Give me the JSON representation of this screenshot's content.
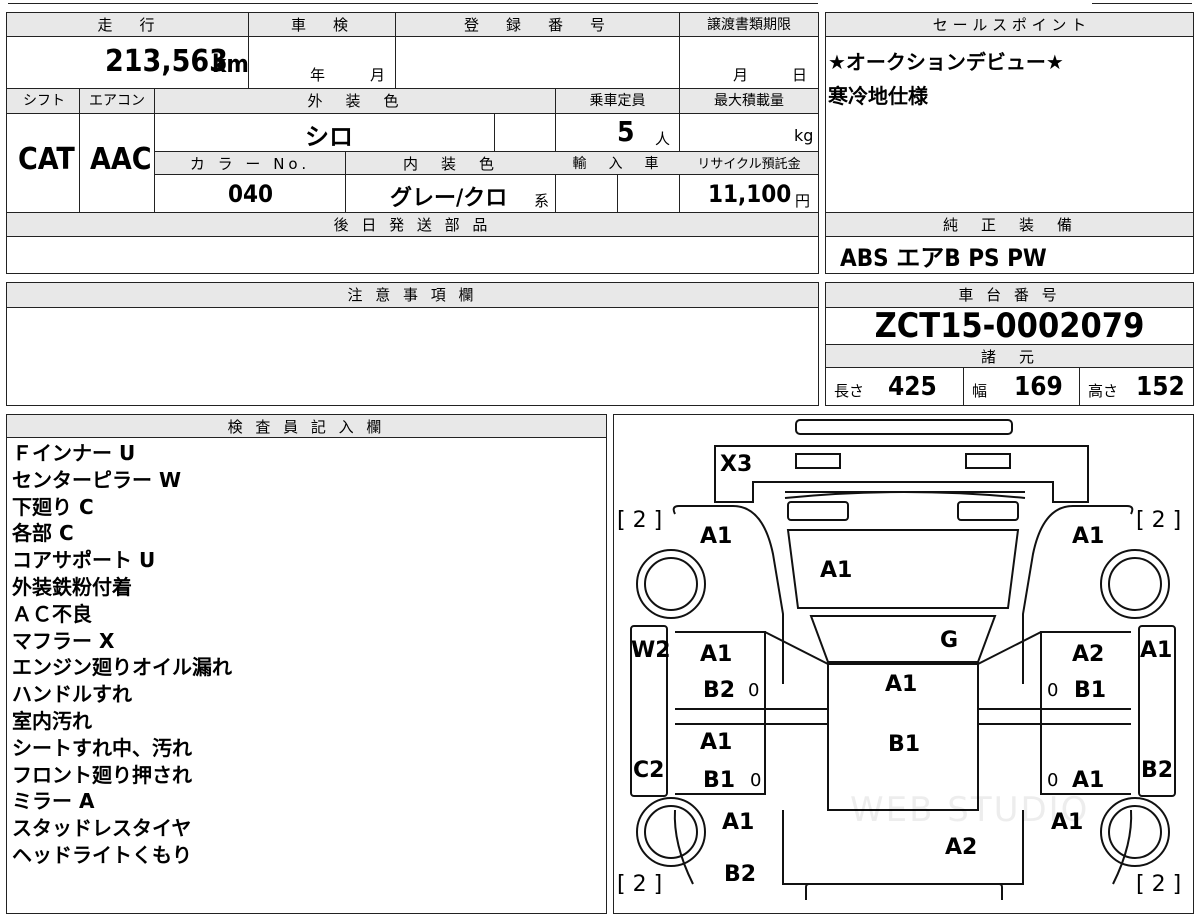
{
  "mileage": {
    "header": "走　行",
    "value": "213,563",
    "unit": "km"
  },
  "inspection": {
    "header": "車　検",
    "year_label": "年",
    "month_label": "月"
  },
  "registration": {
    "header": "登　録　番　号",
    "value": ""
  },
  "transfer": {
    "header": "譲渡書類期限",
    "month_label": "月",
    "day_label": "日"
  },
  "sales_point": {
    "header": "セ ー ル ス ポ イ ン ト",
    "lines": [
      "★オークションデビュー★",
      "寒冷地仕様"
    ]
  },
  "shift": {
    "header": "シフト",
    "value": "CAT"
  },
  "aircon": {
    "header": "エアコン",
    "value": "AAC"
  },
  "exterior_color": {
    "header": "外　装　色",
    "value": "シロ"
  },
  "capacity": {
    "header": "乗車定員",
    "value": "5",
    "unit": "人"
  },
  "max_load": {
    "header": "最大積載量",
    "value": "",
    "unit": "kg"
  },
  "color_no": {
    "header": "カ ラ ー No.",
    "value": "040"
  },
  "interior_color": {
    "header": "内　装　色",
    "value": "グレー/クロ",
    "suffix": "系"
  },
  "import": {
    "header": "輸　入　車",
    "value": ""
  },
  "recycle": {
    "header": "リサイクル預託金",
    "value": "11,100",
    "unit": "円"
  },
  "later_parts": {
    "header": "後 日 発 送 部 品",
    "value": ""
  },
  "genuine_equipment": {
    "header": "純　正　装　備",
    "value": "ABS エアB PS PW"
  },
  "notes": {
    "header": "注 意 事 項 欄",
    "value": ""
  },
  "chassis": {
    "header": "車 台 番 号",
    "value": "ZCT15-0002079"
  },
  "specs": {
    "header": "諸　元",
    "length_label": "長さ",
    "length": "425",
    "width_label": "幅",
    "width": "169",
    "height_label": "高さ",
    "height": "152"
  },
  "inspector": {
    "header": "検 査 員 記 入 欄",
    "lines": [
      "Ｆインナー U",
      "センターピラー W",
      "下廻り C",
      "各部 C",
      "コアサポート U",
      "外装鉄粉付着",
      "ＡＣ不良",
      "マフラー X",
      "エンジン廻りオイル漏れ",
      "ハンドルすれ",
      "室内汚れ",
      "シートすれ中、汚れ",
      "フロント廻り押され",
      "ミラー A",
      "スタッドレスタイヤ",
      "ヘッドライトくもり"
    ]
  },
  "diagram": {
    "bracket_label": "[ 2 ]",
    "damage": {
      "front_bumper": "X3",
      "left_front_fender": "A1",
      "right_front_fender": "A1",
      "hood": "A1",
      "windshield": "G",
      "left_front_door_top": "A1",
      "left_front_door_bottom": "B2",
      "right_front_door_top": "A2",
      "right_front_door_bottom": "B1",
      "roof_front": "A1",
      "roof_back": "B1",
      "left_rear_door_top": "A1",
      "left_rear_door_bottom": "B1",
      "right_rear_door": "A1",
      "left_pillar": "W2",
      "right_pillar": "A1",
      "left_rocker": "C2",
      "right_rocker": "B2",
      "left_rear_fender": "A1",
      "right_rear_fender": "A1",
      "rear_center": "A2",
      "rear_left": "B2"
    },
    "zero_marks": "0",
    "watermark": "WEB STUDIO"
  }
}
